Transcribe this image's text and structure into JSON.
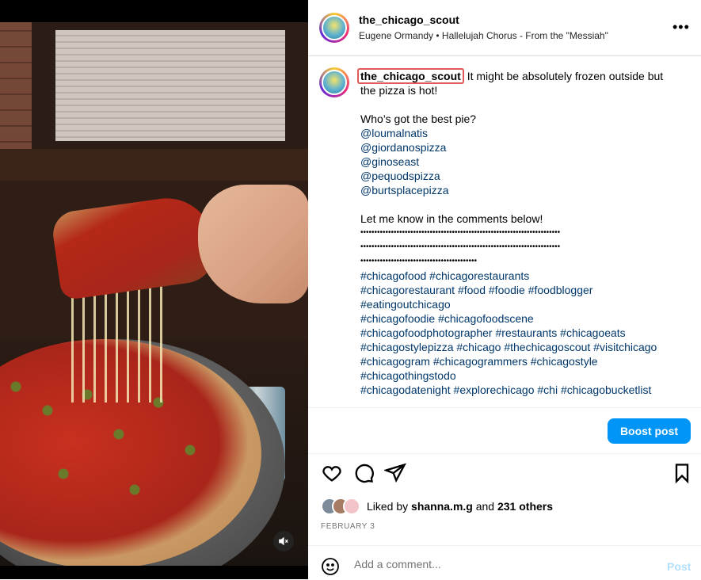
{
  "post": {
    "username": "the_chicago_scout",
    "audio": "Eugene Ormandy • Hallelujah Chorus - From the \"Messiah\"",
    "more_icon": "more-icon",
    "caption": {
      "username": "the_chicago_scout",
      "line1_rest": " It might be absolutely frozen outside but",
      "line2": "the pizza is hot!",
      "question": "Who’s got the best pie?",
      "mentions": [
        "@loumalnatis",
        "@giordanospizza",
        "@ginoseast",
        "@pequodspizza",
        "@burtsplacepizza"
      ],
      "cta": "Let me know in the comments below!",
      "dots1": "••••••••••••••••••••••••••••••••••••••••••••••••••••••••••••••••••••••••",
      "dots2": "••••••••••••••••••••••••••••••••••••••••••••••••••••••••••••••••••••••••",
      "dots3": "••••••••••••••••••••••••••••••••••••••••••",
      "hashtag_lines": [
        "#chicagofood #chicagorestaurants",
        "#chicagorestaurant #food #foodie #foodblogger",
        "#eatingoutchicago",
        "#chicagofoodie #chicagofoodscene",
        "#chicagofoodphotographer #restaurants #chicagoeats",
        "#chicagostylepizza #chicago #thechicagoscout #visitchicago",
        "#chicagogram #chicagogrammers #chicagostyle",
        "#chicagothingstodo",
        "#chicagodatenight #explorechicago #chi #chicagobucketlist"
      ]
    },
    "boost_label": "Boost post",
    "likes": {
      "prefix": "Liked by ",
      "user": "shanna.m.g",
      "middle": " and ",
      "others": "231 others"
    },
    "date": "FEBRUARY 3",
    "comment": {
      "placeholder": "Add a comment...",
      "value": "",
      "post_label": "Post"
    }
  },
  "colors": {
    "accent": "#0095f6",
    "link": "#00376b",
    "muted": "#737373",
    "post_disabled": "#b2dffc"
  }
}
